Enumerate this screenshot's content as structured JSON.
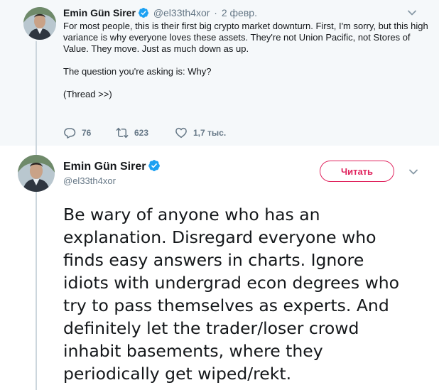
{
  "parent_tweet": {
    "author_name": "Emin Gün Sirer",
    "handle": "@el33th4xor",
    "separator": "·",
    "date": "2 февр.",
    "paragraphs": [
      "For most people, this is their first big crypto market downturn. First, I'm sorry, but this high variance is why everyone loves these assets. They're not Union Pacific, not Stores of Value. They move. Just as much down as up.",
      "The question you're asking is: Why?",
      "(Thread >>)"
    ],
    "replies": "76",
    "retweets": "623",
    "likes": "1,7 тыс."
  },
  "main_tweet": {
    "author_name": "Emin Gün Sirer",
    "handle": "@el33th4xor",
    "follow_label": "Читать",
    "text_lines": [
      "Be wary of anyone who has an",
      "explanation. Disregard everyone who",
      "finds easy answers in charts. Ignore",
      "idiots with undergrad econ degrees who",
      "try to pass themselves as experts. And",
      "definitely let the trader/loser crowd",
      "inhabit basements, where they",
      "periodically get wiped/rekt."
    ]
  },
  "icons": {
    "verified": "verified-badge-icon",
    "caret": "chevron-down-icon",
    "reply": "reply-icon",
    "retweet": "retweet-icon",
    "like": "heart-icon"
  },
  "colors": {
    "verified_blue": "#1da1f2",
    "follow_accent": "#e0245e",
    "muted_text": "#657786",
    "parent_background": "#f5f8fa"
  }
}
